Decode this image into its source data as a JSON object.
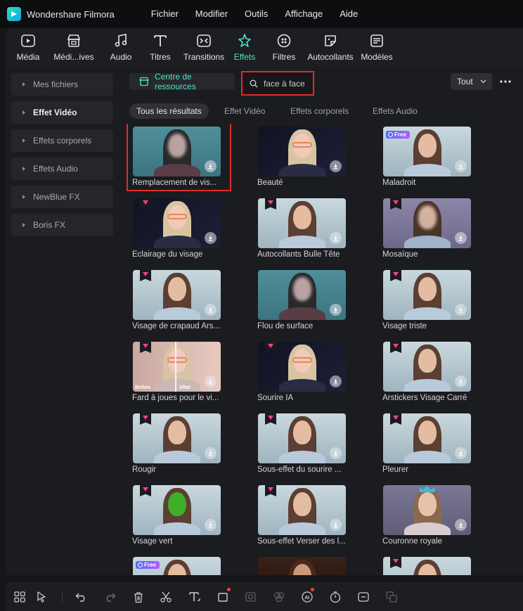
{
  "app": {
    "title": "Wondershare Filmora"
  },
  "menu": [
    "Fichier",
    "Modifier",
    "Outils",
    "Affichage",
    "Aide"
  ],
  "toolbar": {
    "tabs": [
      {
        "label": "Média",
        "icon": "media-icon"
      },
      {
        "label": "Médi...ives",
        "icon": "stock-media-icon"
      },
      {
        "label": "Audio",
        "icon": "music-note-icon"
      },
      {
        "label": "Titres",
        "icon": "text-icon"
      },
      {
        "label": "Transitions",
        "icon": "transition-icon"
      },
      {
        "label": "Effets",
        "icon": "sparkle-effects-icon",
        "active": true
      },
      {
        "label": "Filtres",
        "icon": "filter-icon"
      },
      {
        "label": "Autocollants",
        "icon": "sticker-icon"
      },
      {
        "label": "Modèles",
        "icon": "template-icon"
      }
    ]
  },
  "sidebar": {
    "items": [
      {
        "label": "Mes fichiers"
      },
      {
        "label": "Effet Vidéo",
        "active": true
      },
      {
        "label": "Effets corporels"
      },
      {
        "label": "Effets Audio"
      },
      {
        "label": "NewBlue FX"
      },
      {
        "label": "Boris FX"
      }
    ]
  },
  "main": {
    "resource_center_label": "Centre de ressources",
    "search": {
      "value": "face à face"
    },
    "filter": {
      "selected": "Tout"
    },
    "subtabs": [
      {
        "label": "Tous les résultats",
        "active": true
      },
      {
        "label": "Effet Vidéo"
      },
      {
        "label": "Effets corporels"
      },
      {
        "label": "Effets Audio"
      }
    ],
    "cards": [
      {
        "label": "Remplacement de vis...",
        "tag": "none",
        "theme": "teal-blur",
        "selected": true
      },
      {
        "label": "Beauté",
        "tag": "none",
        "theme": "dark-glasses"
      },
      {
        "label": "Maladroit",
        "tag": "free",
        "theme": "light"
      },
      {
        "label": "Éclairage du visage",
        "tag": "gem",
        "theme": "dark-glasses"
      },
      {
        "label": "Autocollants Bulle Tête",
        "tag": "gem",
        "theme": "light"
      },
      {
        "label": "Mosaïque",
        "tag": "gem",
        "theme": "mosaic"
      },
      {
        "label": "Visage de crapaud Ars...",
        "tag": "gem",
        "theme": "light"
      },
      {
        "label": "Flou de surface",
        "tag": "none",
        "theme": "teal-blur"
      },
      {
        "label": "Visage triste",
        "tag": "gem",
        "theme": "light"
      },
      {
        "label": "Fard à joues pour le vi...",
        "tag": "gem",
        "theme": "before-after"
      },
      {
        "label": "Sourire IA",
        "tag": "gem",
        "theme": "dark-glasses"
      },
      {
        "label": "Arstickers Visage Carré",
        "tag": "gem",
        "theme": "light"
      },
      {
        "label": "Rougir",
        "tag": "gem",
        "theme": "light"
      },
      {
        "label": "Sous-effet du sourire ...",
        "tag": "gem",
        "theme": "light"
      },
      {
        "label": "Pleurer",
        "tag": "gem",
        "theme": "light"
      },
      {
        "label": "Visage vert",
        "tag": "gem",
        "theme": "green"
      },
      {
        "label": "Sous-effet Verser des l...",
        "tag": "gem",
        "theme": "light"
      },
      {
        "label": "Couronne royale",
        "tag": "none",
        "theme": "crown"
      },
      {
        "label": "",
        "tag": "free",
        "theme": "light"
      },
      {
        "label": "",
        "tag": "none",
        "theme": "dark-warm"
      },
      {
        "label": "",
        "tag": "gem",
        "theme": "light"
      }
    ],
    "thumb_badges": {
      "free": "Free",
      "before": "Before",
      "after": "After"
    }
  },
  "bottombar": {
    "icons": [
      "layout-grid-icon",
      "select-arrow-icon",
      "undo-icon",
      "redo-icon",
      "delete-icon",
      "cut-icon",
      "text-tool-icon",
      "crop-icon",
      "mask-icon",
      "color-icon",
      "ai-portrait-icon",
      "timer-icon",
      "speed-icon",
      "translate-icon"
    ]
  },
  "colors": {
    "accent": "#4fe3c4",
    "highlight": "#e02b2b",
    "gem": "#ff3f8a",
    "bg": "#151619",
    "panel": "#1b1c20"
  }
}
